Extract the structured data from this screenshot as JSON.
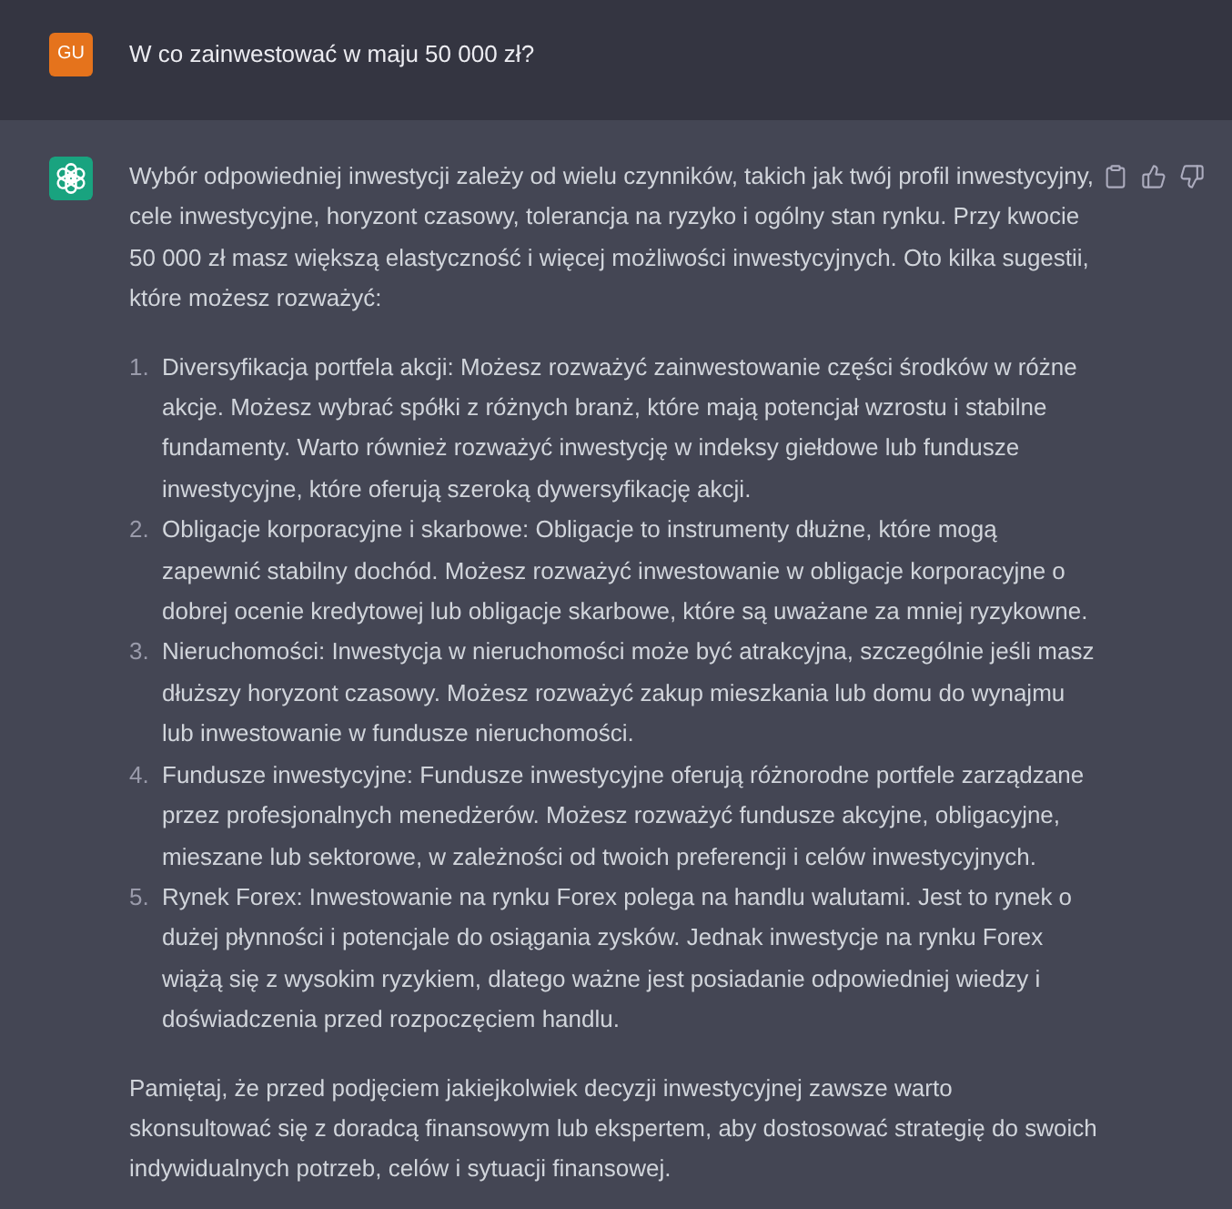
{
  "user_message": {
    "avatar_initials": "GU",
    "text": "W co zainwestować w maju 50 000 zł?"
  },
  "assistant_message": {
    "intro": "Wybór odpowiedniej inwestycji zależy od wielu czynników, takich jak twój profil inwestycyjny, cele inwestycyjne, horyzont czasowy, tolerancja na ryzyko i ogólny stan rynku. Przy kwocie 50 000 zł masz większą elastyczność i więcej możliwości inwestycyjnych. Oto kilka sugestii, które możesz rozważyć:",
    "items": [
      {
        "number": "1.",
        "text": "Diversyfikacja portfela akcji: Możesz rozważyć zainwestowanie części środków w różne akcje. Możesz wybrać spółki z różnych branż, które mają potencjał wzrostu i stabilne fundamenty. Warto również rozważyć inwestycję w indeksy giełdowe lub fundusze inwestycyjne, które oferują szeroką dywersyfikację akcji."
      },
      {
        "number": "2.",
        "text": "Obligacje korporacyjne i skarbowe: Obligacje to instrumenty dłużne, które mogą zapewnić stabilny dochód. Możesz rozważyć inwestowanie w obligacje korporacyjne o dobrej ocenie kredytowej lub obligacje skarbowe, które są uważane za mniej ryzykowne."
      },
      {
        "number": "3.",
        "text": "Nieruchomości: Inwestycja w nieruchomości może być atrakcyjna, szczególnie jeśli masz dłuższy horyzont czasowy. Możesz rozważyć zakup mieszkania lub domu do wynajmu lub inwestowanie w fundusze nieruchomości."
      },
      {
        "number": "4.",
        "text": "Fundusze inwestycyjne: Fundusze inwestycyjne oferują różnorodne portfele zarządzane przez profesjonalnych menedżerów. Możesz rozważyć fundusze akcyjne, obligacyjne, mieszane lub sektorowe, w zależności od twoich preferencji i celów inwestycyjnych."
      },
      {
        "number": "5.",
        "text": "Rynek Forex: Inwestowanie na rynku Forex polega na handlu walutami. Jest to rynek o dużej płynności i potencjale do osiągania zysków. Jednak inwestycje na rynku Forex wiążą się z wysokim ryzykiem, dlatego ważne jest posiadanie odpowiedniej wiedzy i doświadczenia przed rozpoczęciem handlu."
      }
    ],
    "closing": "Pamiętaj, że przed podjęciem jakiejkolwiek decyzji inwestycyjnej zawsze warto skonsultować się z doradcą finansowym lub ekspertem, aby dostosować strategię do swoich indywidualnych potrzeb, celów i sytuacji finansowej."
  }
}
